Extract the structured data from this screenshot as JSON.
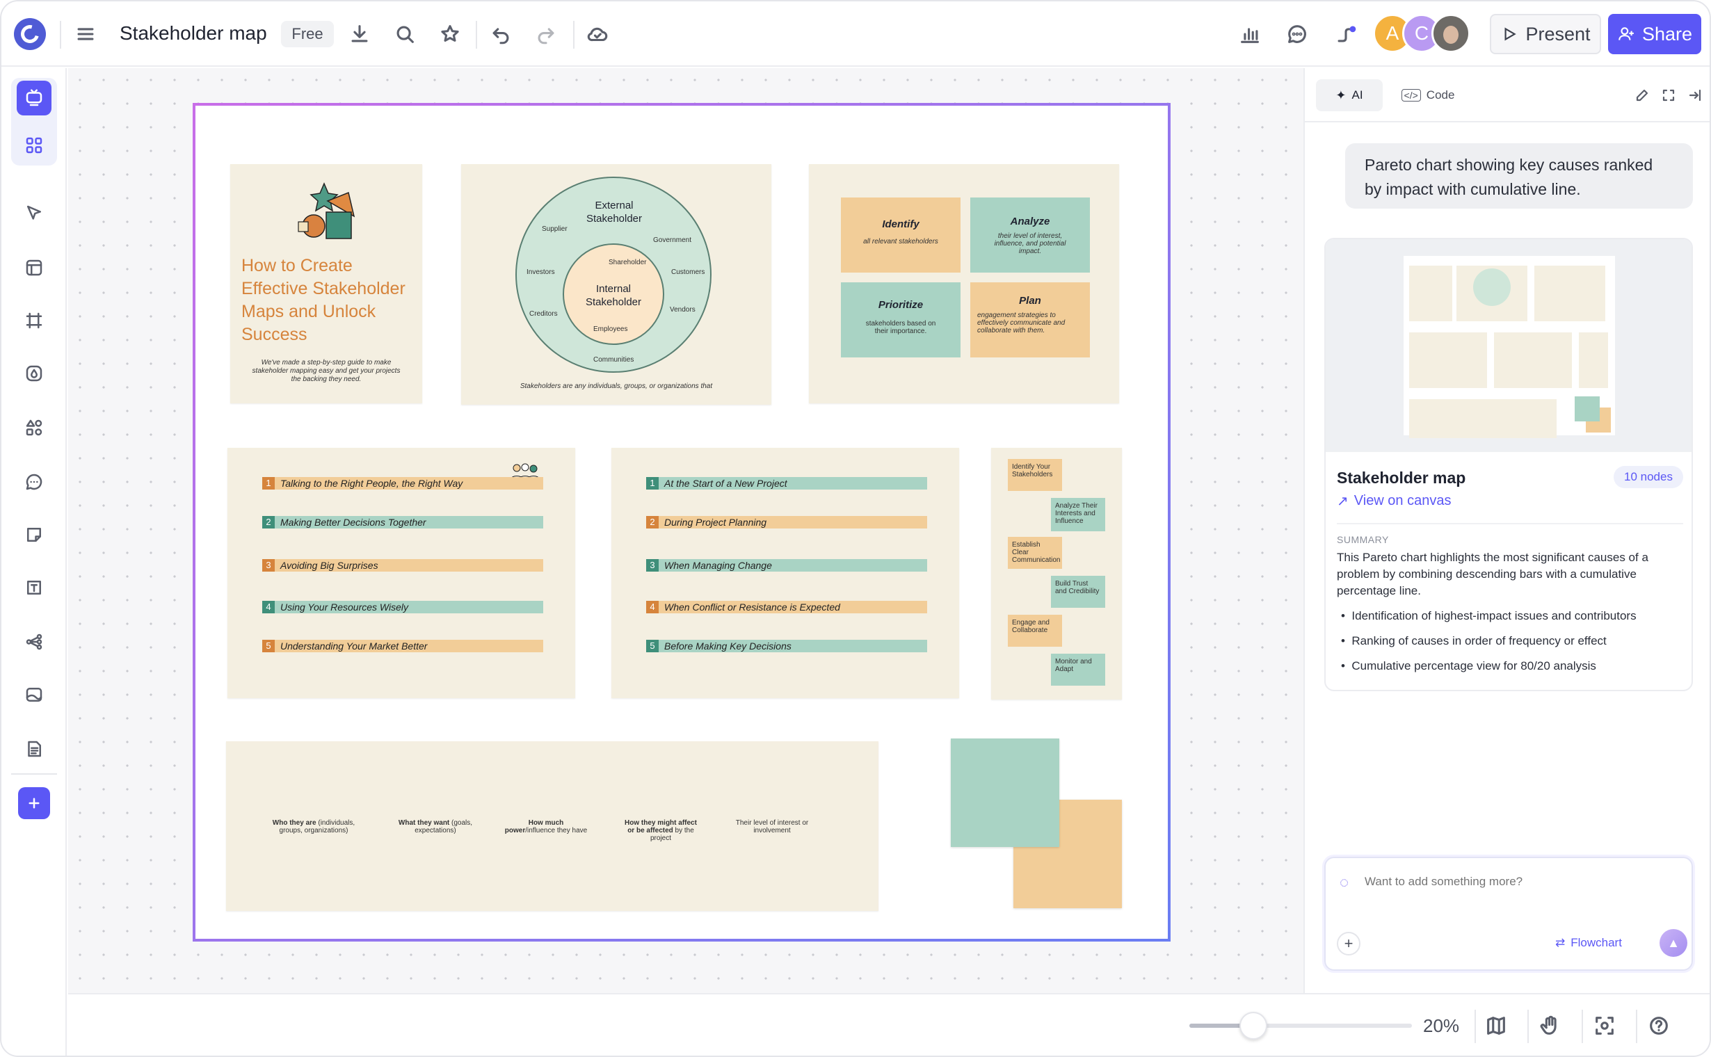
{
  "app": {
    "title": "Stakeholder map",
    "plan_badge": "Free",
    "avatars": [
      "A",
      "C"
    ],
    "present_label": "Present",
    "share_label": "Share"
  },
  "canvas": {
    "card1": {
      "title": "How to Create Effective Stakeholder Maps and Unlock Success",
      "subtitle": "We've made a step-by-step guide to make stakeholder mapping easy and get your projects the backing they need."
    },
    "card2": {
      "outer": "External Stakeholder",
      "inner": "Internal Stakeholder",
      "outer_labels": [
        "Supplier",
        "Government",
        "Investors",
        "Customers",
        "Creditors",
        "Vendors",
        "Communities"
      ],
      "inner_labels": [
        "Shareholder",
        "Employees"
      ],
      "caption": "Stakeholders are any individuals, groups, or organizations that"
    },
    "card3": {
      "boxes": [
        {
          "title": "Identify",
          "text": "all relevant stakeholders"
        },
        {
          "title": "Analyze",
          "text": "their level of interest, influence, and potential impact."
        },
        {
          "title": "Prioritize",
          "text": "stakeholders based on their importance."
        },
        {
          "title": "Plan",
          "text": "engagement strategies to effectively communicate and collaborate with them."
        }
      ]
    },
    "card4": {
      "items": [
        "Talking to the Right People, the Right Way",
        "Making Better Decisions Together",
        "Avoiding Big Surprises",
        "Using Your Resources Wisely",
        "Understanding Your Market Better"
      ]
    },
    "card5": {
      "items": [
        "At the Start of a New Project",
        "During Project Planning",
        "When Managing Change",
        "When Conflict or Resistance is Expected",
        "Before Making Key Decisions"
      ]
    },
    "card6": {
      "steps": [
        "Identify Your Stakeholders",
        "Analyze Their Interests and Influence",
        "Establish Clear Communication",
        "Build Trust and Credibility",
        "Engage and Collaborate",
        "Monitor and Adapt"
      ]
    },
    "card7": {
      "cols": [
        {
          "b": "Who they are",
          "r": " (individuals, groups, organizations)"
        },
        {
          "b": "What they want",
          "r": " (goals, expectations)"
        },
        {
          "b": "How much power",
          "r": "/influence they have"
        },
        {
          "b": "How they might affect or be affected",
          "r": " by the project"
        },
        {
          "b": "",
          "r": "Their level of interest or involvement"
        }
      ]
    }
  },
  "panel": {
    "tabs": [
      "AI",
      "Code"
    ],
    "prompt": "Pareto chart showing key causes ranked by impact with cumulative line.",
    "result_title": "Stakeholder map",
    "nodes_badge": "10 nodes",
    "view_link": "View on canvas",
    "summary_label": "SUMMARY",
    "summary": "This Pareto chart highlights the most significant causes of a problem by combining descending bars with a cumulative percentage line.",
    "bullets": [
      "Identification of highest-impact issues and contributors",
      "Ranking of causes in order of frequency or effect",
      "Cumulative percentage view for 80/20 analysis"
    ],
    "input_placeholder": "Want to add something more?",
    "mode_label": "Flowchart"
  },
  "zoom": {
    "label": "20%",
    "value": 20
  }
}
